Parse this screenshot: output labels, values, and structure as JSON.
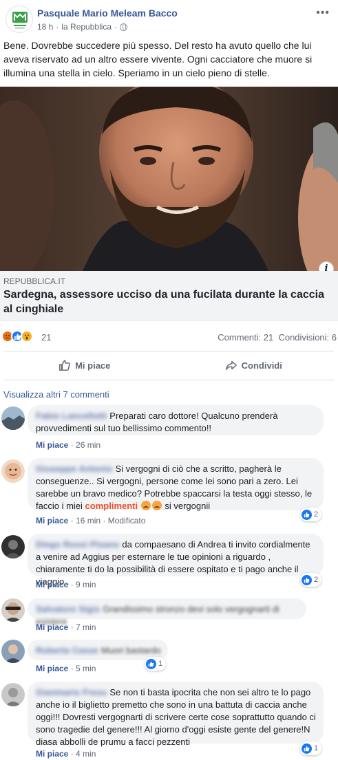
{
  "post": {
    "author": "Pasquale Mario Meleam Bacco",
    "time": "18 h",
    "separator": "·",
    "source": "la Repubblica",
    "text": "Bene. Dovrebbe succedere più spesso. Del resto ha avuto quello che lui aveva riservato ad un altro essere vivente. Ogni cacciatore che muore si illumina una stella in cielo. Speriamo in un cielo pieno di stelle."
  },
  "link": {
    "source": "REPUBBLICA.IT",
    "title": "Sardegna, assessore ucciso da una fucilata durante la caccia al cinghiale"
  },
  "stats": {
    "reaction_count": "21",
    "comments": "Commenti: 21",
    "shares": "Condivisioni: 6"
  },
  "actions": {
    "like": "Mi piace",
    "share": "Condividi"
  },
  "view_more": "Visualizza altri 7 commenti",
  "comments": [
    {
      "name": "Fabio Lancellotti",
      "text": "Preparati caro dottore! Qualcuno prenderà provvedimenti sul tuo bellissimo commento!!",
      "like": "Mi piace",
      "time": "26 min"
    },
    {
      "name": "Giuseppe Antonio",
      "text_before": "Si vergogni di ciò che a scritto, pagherà le conseguenze.. Si vergogni, persone come lei sono pari a zero. Lei sarebbe un bravo medico? Potrebbe spaccarsi la testa oggi stesso, le faccio i miei",
      "text_highlight": "complimenti",
      "text_after": "si vergognii",
      "like": "Mi piace",
      "time": "16 min",
      "edited": "Modificato",
      "reactions": "2"
    },
    {
      "name": "Diego Rossi Pisano",
      "text": "da compaesano di Andrea ti invito cordialmente a venire ad Aggius per esternare le tue opinioni a riguardo , chiaramente ti do la possibilità di essere ospitato e ti pago anche il viaggio .",
      "like": "Mi piace",
      "time": "9 min",
      "reactions": "2"
    },
    {
      "name": "Salvatore Sigis",
      "text": "Grandissimo stronzo devi solo vergognarti di esistere",
      "like": "Mi piace",
      "time": "7 min"
    },
    {
      "name": "Roberta Casse",
      "text": "Muori bastardo",
      "like": "Mi piace",
      "time": "5 min",
      "reactions": "1"
    },
    {
      "name": "Gianmario Fresu",
      "text": "Se non ti basta ipocrita che non sei altro te lo pago anche io il biglietto premetto che sono in una battuta di caccia anche oggi!!! Dovresti vergognarti di scrivere certe cose soprattutto quando ci sono tragedie del genere!!! Al giorno d'oggi esiste gente del genere!N diasa abbolli de prumu a facci pezzenti",
      "like": "Mi piace",
      "time": "4 min",
      "reactions": "1"
    }
  ],
  "colors": {
    "link_blue": "#385898",
    "gray_text": "#606770",
    "bubble_bg": "#f2f3f5",
    "like_blue": "#1877f2",
    "highlight": "#e9532f"
  }
}
